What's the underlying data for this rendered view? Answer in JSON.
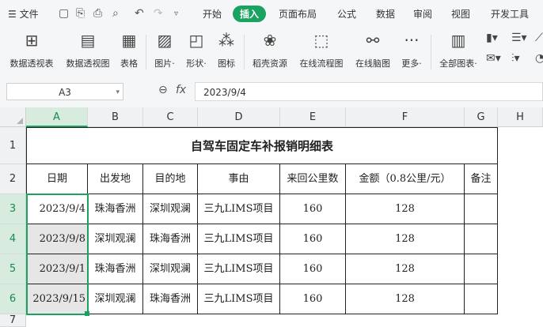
{
  "menubar": {
    "file_label": "文件",
    "tabs": [
      "开始",
      "插入",
      "页面布局",
      "公式",
      "数据",
      "审阅",
      "视图",
      "开发工具"
    ],
    "active_tab": "插入"
  },
  "ribbon": {
    "buttons": [
      {
        "label": "数据透视表",
        "icon": "pivot-table-icon"
      },
      {
        "label": "数据透视图",
        "icon": "pivot-chart-icon"
      },
      {
        "label": "表格",
        "icon": "table-icon"
      },
      {
        "label": "图片·",
        "icon": "picture-icon"
      },
      {
        "label": "形状·",
        "icon": "shape-icon"
      },
      {
        "label": "图标",
        "icon": "icons-icon"
      },
      {
        "label": "稻壳资源",
        "icon": "docer-resource-icon"
      },
      {
        "label": "在线流程图",
        "icon": "flowchart-icon"
      },
      {
        "label": "在线脑图",
        "icon": "mindmap-icon"
      },
      {
        "label": "更多·",
        "icon": "more-icon"
      },
      {
        "label": "全部图表·",
        "icon": "all-charts-icon"
      }
    ]
  },
  "formula_bar": {
    "name_box": "A3",
    "formula": "2023/9/4"
  },
  "columns": [
    "A",
    "B",
    "C",
    "D",
    "E",
    "F",
    "G",
    "H"
  ],
  "selected_column": "A",
  "rows": [
    "1",
    "2",
    "3",
    "4",
    "5",
    "6",
    "7"
  ],
  "sheet": {
    "title": "自驾车固定车补报销明细表",
    "headers": [
      "日期",
      "出发地",
      "目的地",
      "事由",
      "来回公里数",
      "金额（0.8公里/元）",
      "备注"
    ],
    "data": [
      [
        "2023/9/4",
        "珠海香洲",
        "深圳观澜",
        "三九LIMS项目",
        "160",
        "128",
        ""
      ],
      [
        "2023/9/8",
        "深圳观澜",
        "珠海香洲",
        "三九LIMS项目",
        "160",
        "128",
        ""
      ],
      [
        "2023/9/1",
        "珠海香洲",
        "深圳观澜",
        "三九LIMS项目",
        "160",
        "128",
        ""
      ],
      [
        "2023/9/15",
        "深圳观澜",
        "珠海香洲",
        "三九LIMS项目",
        "160",
        "128",
        ""
      ]
    ]
  },
  "colors": {
    "accent": "#1aa260",
    "selected_header": "#d7ebdf"
  }
}
